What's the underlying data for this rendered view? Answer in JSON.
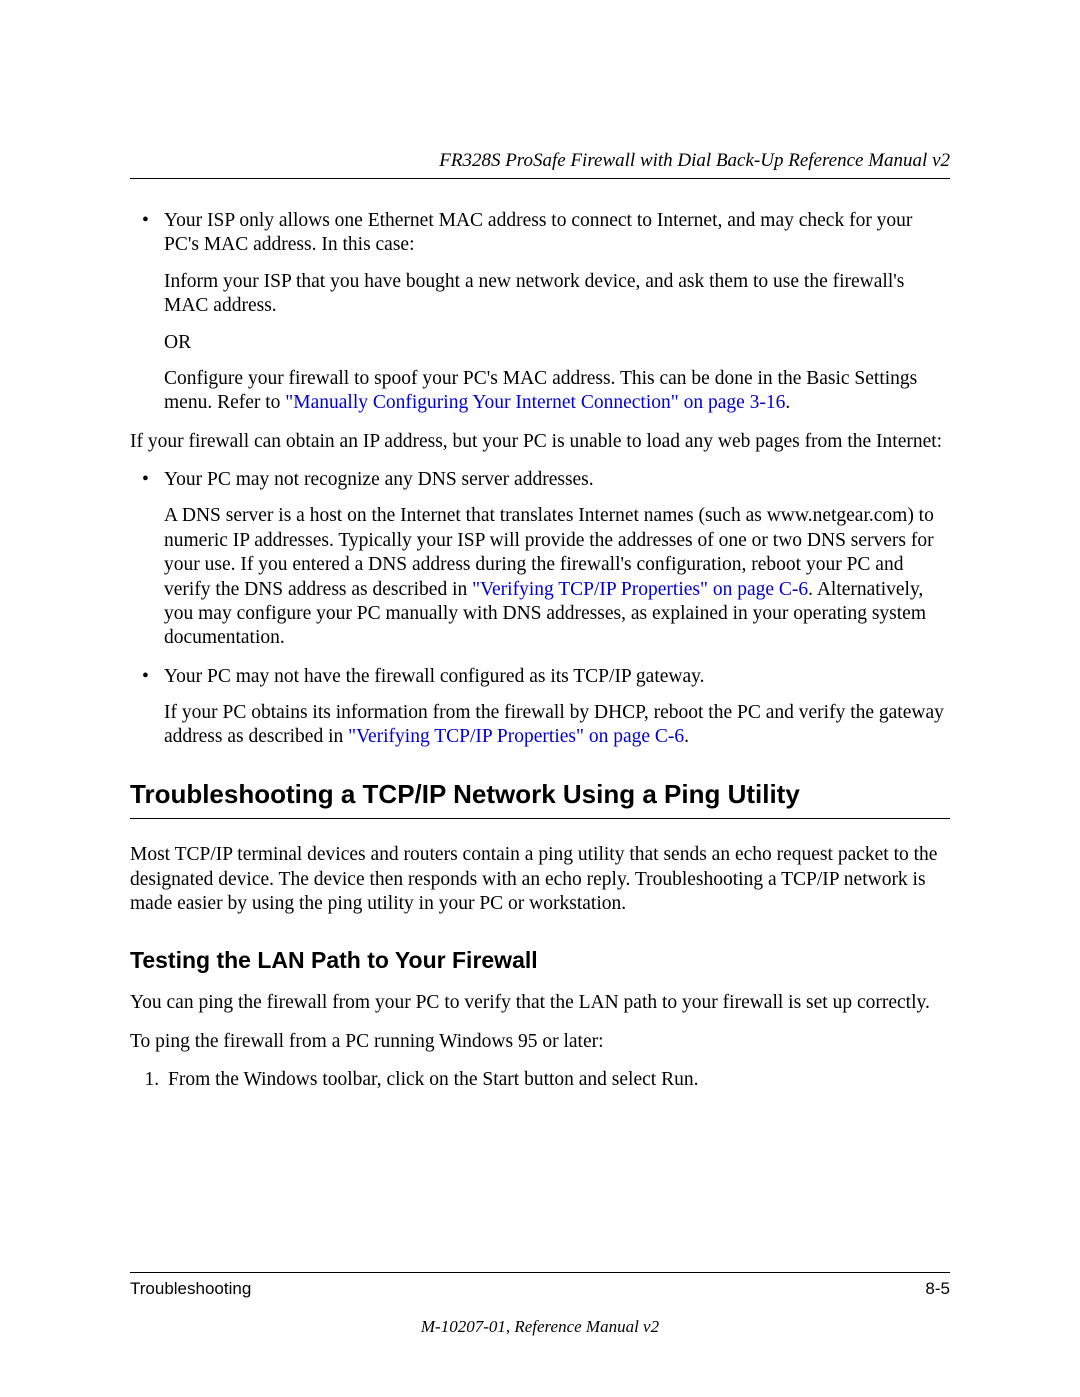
{
  "header": {
    "running_title": "FR328S ProSafe Firewall with Dial Back-Up Reference Manual v2"
  },
  "body": {
    "bullet1_intro": "Your ISP only allows one Ethernet MAC address to connect to Internet, and may check for your PC's MAC address. In this case:",
    "bullet1_p1": "Inform your ISP that you have bought a new network device, and ask them to use the firewall's MAC address.",
    "bullet1_or": "OR",
    "bullet1_p2a": "Configure your firewall to spoof your PC's MAC address. This can be done in the Basic Settings menu. Refer to ",
    "bullet1_link": "\"Manually Configuring Your Internet Connection\" on page 3-16",
    "bullet1_p2b": ".",
    "intro2": "If your firewall can obtain an IP address, but your PC is unable to load any web pages from the Internet:",
    "bullet2a_intro": "Your PC may not recognize any DNS server addresses.",
    "bullet2a_p_a": "A DNS server is a host on the Internet that translates Internet names (such as www.netgear.com) to numeric IP addresses. Typically your ISP will provide the addresses of one or two DNS servers for your use. If you entered a DNS address during the firewall's configuration, reboot your PC and verify the DNS address as described in ",
    "bullet2a_link": "\"Verifying TCP/IP Properties\" on page C-6",
    "bullet2a_p_b": ". Alternatively, you may configure your PC manually with DNS addresses, as explained in your operating system documentation.",
    "bullet2b_intro": "Your PC may not have the firewall configured as its TCP/IP gateway.",
    "bullet2b_p_a": "If your PC obtains its information from the firewall by DHCP, reboot the PC and verify the gateway address as described in ",
    "bullet2b_link": "\"Verifying TCP/IP Properties\" on page C-6",
    "bullet2b_p_b": ".",
    "section_heading": "Troubleshooting a TCP/IP Network Using a Ping Utility",
    "section_para": "Most TCP/IP terminal devices and routers contain a ping utility that sends an echo request packet to the designated device. The device then responds with an echo reply. Troubleshooting a TCP/IP network is made easier by using the ping utility in your PC or workstation.",
    "subsection_heading": "Testing the LAN Path to Your Firewall",
    "sub_p1": "You can ping the firewall from your PC to verify that the LAN path to your firewall is set up correctly.",
    "sub_p2": "To ping the firewall from a PC running Windows 95 or later:",
    "step1": "From the Windows toolbar, click on the Start button and select Run."
  },
  "footer": {
    "left": "Troubleshooting",
    "right": "8-5",
    "sub": "M-10207-01, Reference Manual v2"
  }
}
